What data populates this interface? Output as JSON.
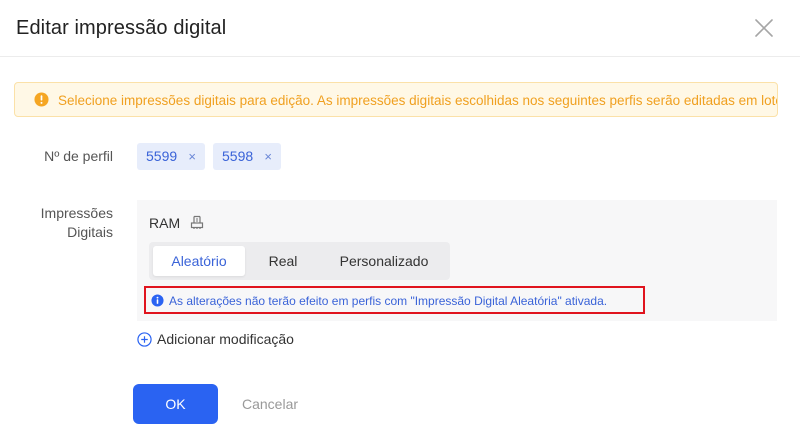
{
  "dialog": {
    "title": "Editar impressão digital"
  },
  "alert": {
    "text": "Selecione impressões digitais para edição. As impressões digitais escolhidas nos seguintes perfis serão editadas em lote."
  },
  "profile": {
    "label": "Nº de perfil",
    "tags": [
      {
        "value": "5599",
        "remove": "×"
      },
      {
        "value": "5598",
        "remove": "×"
      }
    ]
  },
  "fingerprints": {
    "label_line1": "Impressões",
    "label_line2": "Digitais",
    "item_label": "RAM",
    "modes": [
      {
        "label": "Aleatório",
        "selected": true
      },
      {
        "label": "Real",
        "selected": false
      },
      {
        "label": "Personalizado",
        "selected": false
      }
    ],
    "note": "As alterações não terão efeito em perfis com \"Impressão Digital Aleatória\" ativada."
  },
  "add_modification": {
    "label": "Adicionar modificação"
  },
  "footer": {
    "ok_label": "OK",
    "cancel_label": "Cancelar"
  },
  "colors": {
    "accent": "#2a63f2",
    "link_blue": "#3a63d8",
    "warning": "#f0a020",
    "highlight_border": "#e0141e"
  }
}
